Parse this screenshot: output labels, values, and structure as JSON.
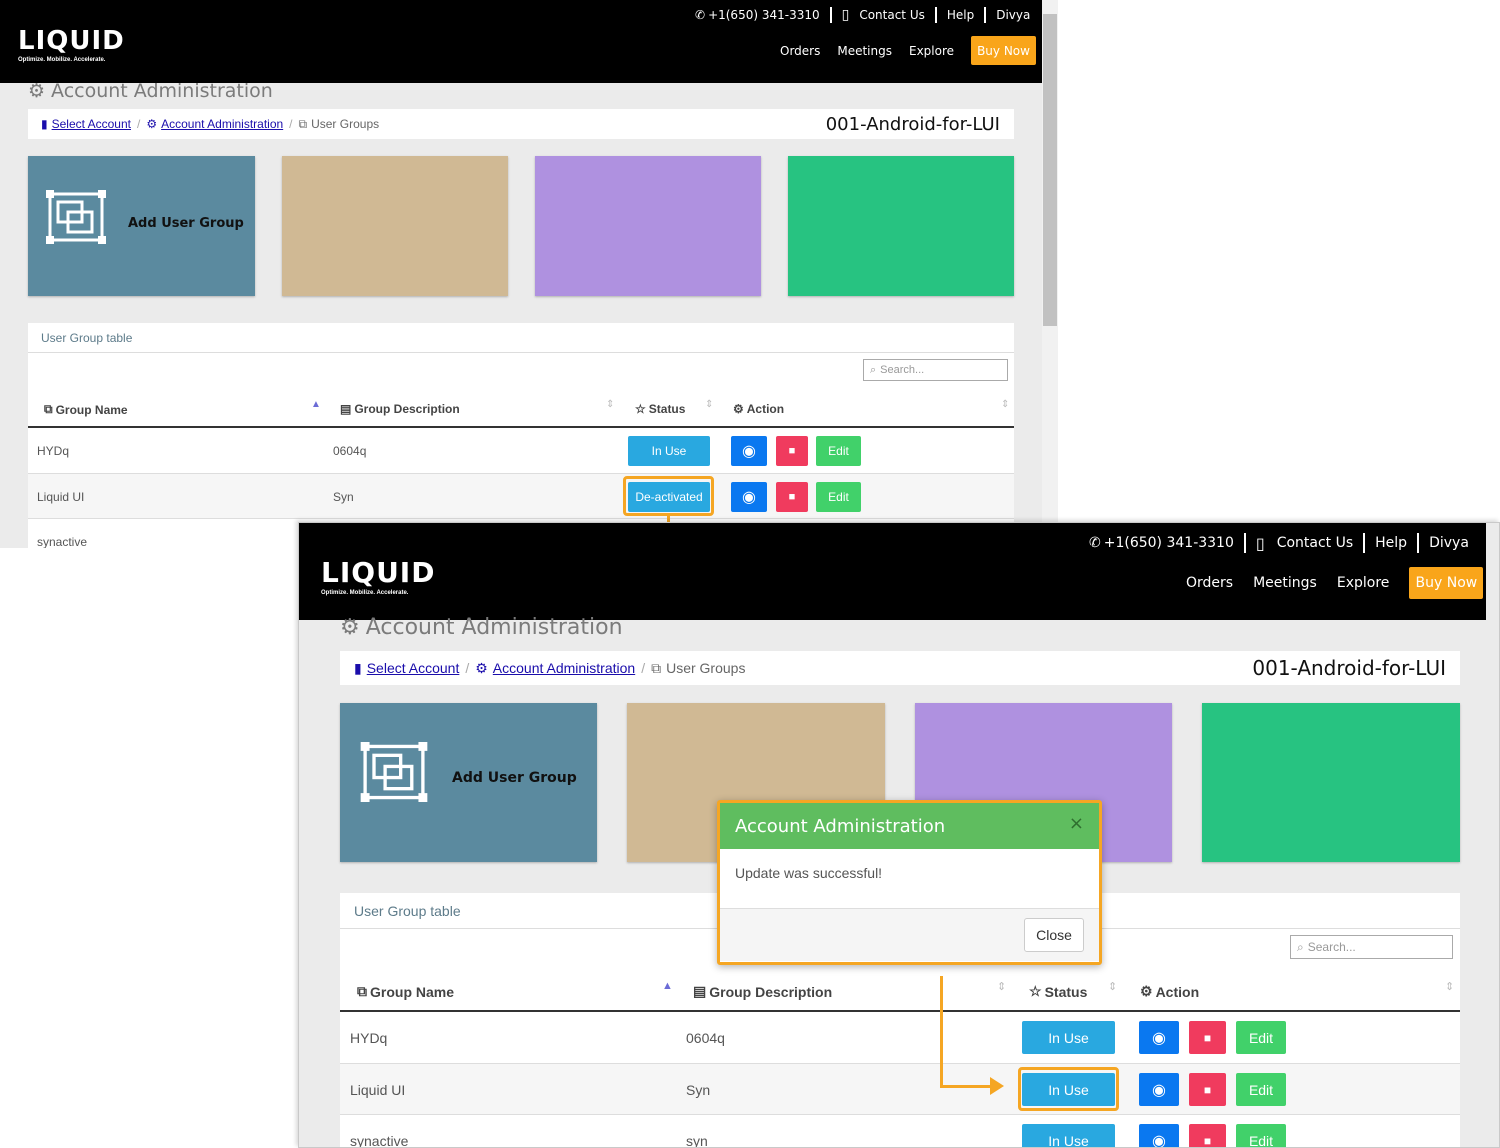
{
  "header": {
    "logo_text": "LIQUID",
    "logo_tagline": "Optimize. Mobilize. Accelerate.",
    "phone": "+1(650) 341-3310",
    "contact": "Contact Us",
    "help": "Help",
    "user": "Divya",
    "nav": {
      "orders": "Orders",
      "meetings": "Meetings",
      "explore": "Explore",
      "buy": "Buy Now"
    }
  },
  "page": {
    "title": "Account Administration",
    "breadcrumb": {
      "select_account": "Select Account",
      "account_admin": "Account Administration",
      "user_groups": "User Groups"
    },
    "account_name": "001-Android-for-LUI"
  },
  "tiles": {
    "add_user_group": "Add User Group"
  },
  "table": {
    "heading": "User Group table",
    "search_placeholder": "Search...",
    "columns": {
      "name": "Group Name",
      "description": "Group Description",
      "status": "Status",
      "action": "Action"
    },
    "edit_label": "Edit"
  },
  "before": {
    "rows": [
      {
        "name": "HYDq",
        "description": "0604q",
        "status": "In Use"
      },
      {
        "name": "Liquid UI",
        "description": "Syn",
        "status": "De-activated"
      },
      {
        "name": "synactive",
        "description": "",
        "status": ""
      }
    ]
  },
  "after": {
    "rows": [
      {
        "name": "HYDq",
        "description": "0604q",
        "status": "In Use"
      },
      {
        "name": "Liquid UI",
        "description": "Syn",
        "status": "In Use"
      },
      {
        "name": "synactive",
        "description": "syn",
        "status": "In Use"
      }
    ],
    "modal": {
      "title": "Account Administration",
      "message": "Update was successful!",
      "close": "Close"
    }
  },
  "colors": {
    "tile_blue": "#5b8a9f",
    "tile_tan": "#d0b994",
    "tile_purple": "#af91e0",
    "tile_green": "#27c381",
    "highlight": "#f5a623",
    "buy": "#f9a51a"
  }
}
